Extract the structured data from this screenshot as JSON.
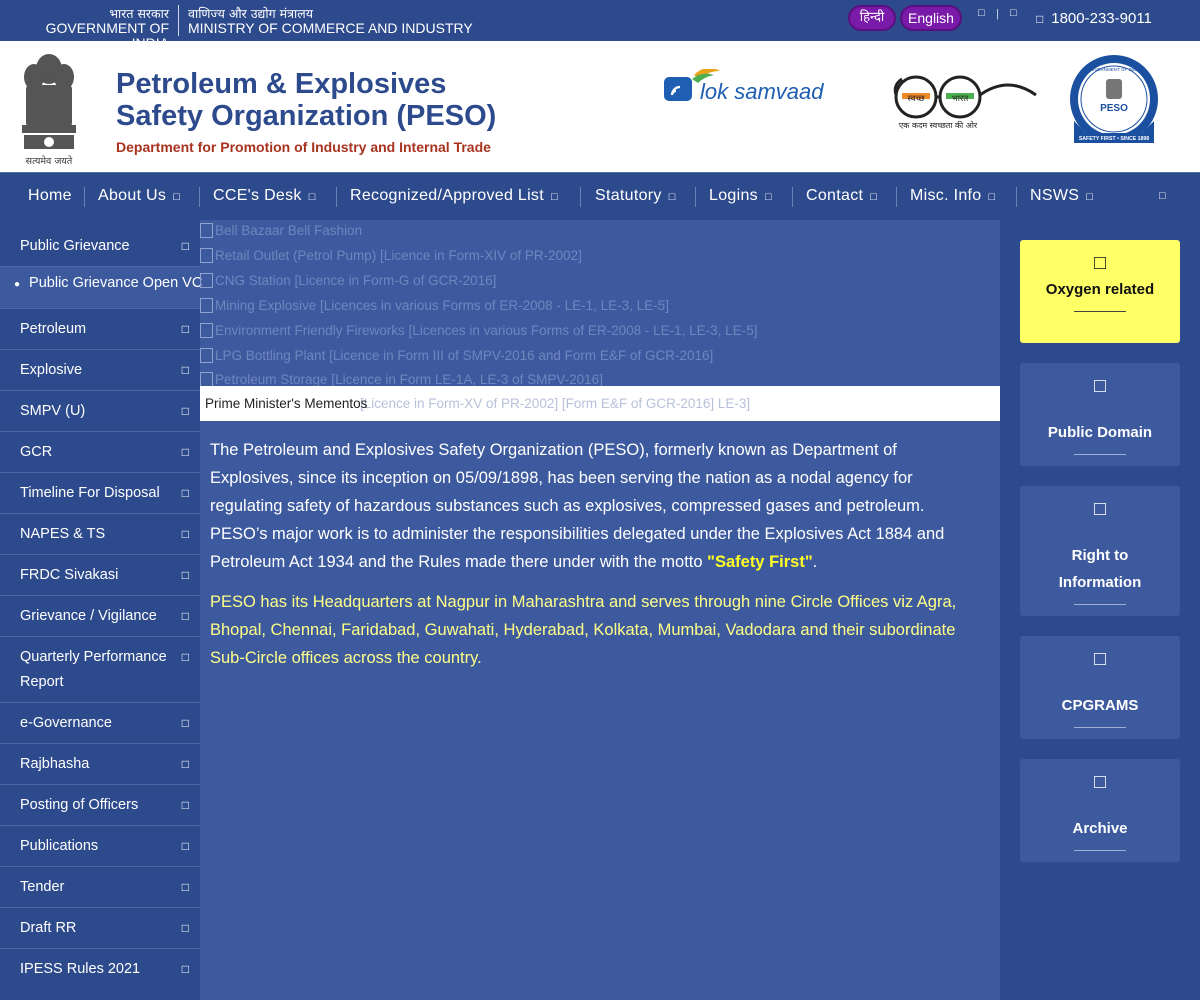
{
  "topbar": {
    "gov_hi": "भारत सरकार",
    "gov_en": "GOVERNMENT OF INDIA",
    "ministry_hi": "वाणिज्य और उद्योग मंत्रालय",
    "ministry_en": "MINISTRY OF COMMERCE AND INDUSTRY",
    "lang_hindi": "हिन्दी",
    "lang_english": "English",
    "phone": "1800-233-9011",
    "icons": [
      "screen-reader-icon",
      "sitemap-icon",
      "phone-icon"
    ]
  },
  "header": {
    "title_line1": "Petroleum & Explosives",
    "title_line2": "Safety Organization (PESO)",
    "subtitle": "Department for Promotion of Industry and Internal Trade",
    "emblem_motto": "सत्यमेव जयते",
    "lok_samvaad": "lok samvaad",
    "swachh_left": "स्वच्छ",
    "swachh_right": "भारत",
    "swachh_tagline": "एक कदम स्वच्छता की ओर",
    "seal_top": "GOVERNMENT OF INDIA",
    "seal_center": "PESO",
    "seal_bottom": "SAFETY FIRST • SINCE 1898"
  },
  "nav": {
    "items": [
      "Home",
      "About Us",
      "CCE's Desk",
      "Recognized/Approved List",
      "Statutory",
      "Logins",
      "Contact",
      "Misc. Info",
      "NSWS"
    ],
    "caret_icon": "chevron-down-icon"
  },
  "sidebar": {
    "items": [
      "Public Grievance",
      "Public Grievance Open VC",
      "Petroleum",
      "Explosive",
      "SMPV (U)",
      "GCR",
      "Timeline For Disposal",
      "NAPES & TS",
      "FRDC Sivakasi",
      "Grievance / Vigilance",
      "Quarterly Performance Report",
      "e-Governance",
      "Rajbhasha",
      "Posting of Officers",
      "Publications",
      "Tender",
      "Draft RR",
      "IPESS Rules 2021"
    ]
  },
  "slider": {
    "lines": [
      "Bell Bazaar Bell Fashion",
      "Retail Outlet (Petrol Pump) [Licence in Form-XIV of PR-2002]",
      "CNG Station [Licence in Form-G of GCR-2016]",
      "Mining Explosive [Licences in various Forms of ER-2008 - LE-1, LE-3, LE-5]",
      "Environment Friendly Fireworks [Licences in various Forms of ER-2008 - LE-1, LE-3, LE-5]",
      "LPG Bottling Plant [Licence in Form III of SMPV-2016 and Form E&F of GCR-2016]",
      "Petroleum Storage [Licence in Form LE-1A, LE-3 of SMPV-2016]"
    ],
    "caption": "Prime Minister's Mementos",
    "caption_ghost": "[Licence in Form-XV of PR-2002] [Form E&F of GCR-2016]  LE-3]"
  },
  "content": {
    "para1_before": "The Petroleum and Explosives Safety Organization (PESO), formerly known as Department of Explosives, since its inception on 05/09/1898, has been serving the nation as a nodal agency for regulating safety of hazardous substances such as explosives, compressed gases and petroleum. PESO’s major work is to administer the responsibilities delegated under the Explosives Act 1884 and Petroleum Act 1934 and the Rules made there under with the motto ",
    "para1_highlight": "\"Safety First\"",
    "para1_after": ".",
    "para2": "PESO has its Headquarters at Nagpur in Maharashtra and serves through nine Circle Offices viz Agra, Bhopal, Chennai, Faridabad, Guwahati, Hyderabad, Kolkata, Mumbai, Vadodara and their subordinate Sub-Circle offices across the country."
  },
  "quicklinks": [
    {
      "label": "Oxygen related",
      "icon": "oxygen-icon",
      "color": "#ffff66"
    },
    {
      "label": "Public Domain",
      "icon": "globe-icon",
      "color": "#3d5a9e"
    },
    {
      "label": "Right to Information",
      "icon": "info-icon",
      "color": "#3d5a9e"
    },
    {
      "label": "CPGRAMS",
      "icon": "grievance-icon",
      "color": "#3d5a9e"
    },
    {
      "label": "Archive",
      "icon": "archive-icon",
      "color": "#3d5a9e"
    }
  ],
  "colors": {
    "primary_blue": "#2d4a8c",
    "content_blue": "#3d5a9e",
    "lang_purple": "#7a1aa8",
    "highlight_yellow": "#ffff22",
    "subtitle_red": "#a8321e"
  }
}
